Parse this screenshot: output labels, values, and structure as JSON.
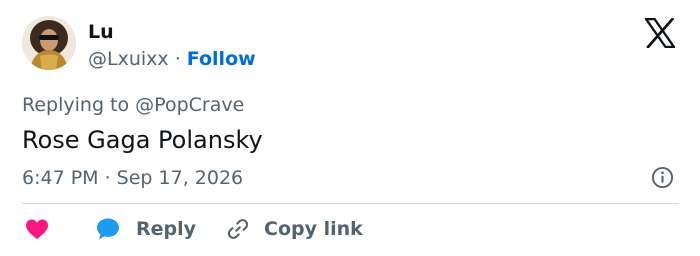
{
  "user": {
    "display_name": "Lu",
    "handle": "@Lxuixx",
    "separator": "·",
    "follow_label": "Follow"
  },
  "tweet": {
    "replying_prefix": "Replying to",
    "replying_to": "@PopCrave",
    "text": "Rose Gaga Polansky",
    "timestamp": "6:47 PM · Sep 17, 2026"
  },
  "actions": {
    "reply_label": "Reply",
    "copy_link_label": "Copy link"
  },
  "icons": {
    "logo": "x-logo-icon",
    "info": "info-icon",
    "like": "heart-icon",
    "reply": "speech-bubble-icon",
    "copy": "link-icon"
  },
  "colors": {
    "text": "#0f1419",
    "secondary": "#536471",
    "follow": "#006fd6",
    "heart": "#f91880",
    "reply_bubble": "#1d9bf0",
    "divider": "#cfd9de"
  }
}
